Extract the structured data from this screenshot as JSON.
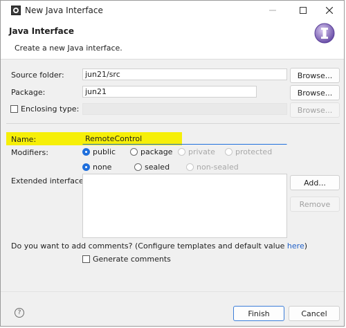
{
  "window": {
    "title": "New Java Interface"
  },
  "header": {
    "title": "Java Interface",
    "description": "Create a new Java interface."
  },
  "source_folder": {
    "label": "Source folder:",
    "value": "jun21/src",
    "browse_label": "Browse..."
  },
  "package": {
    "label": "Package:",
    "value": "jun21",
    "browse_label": "Browse..."
  },
  "enclosing_type": {
    "label": "Enclosing type:",
    "value": "",
    "browse_label": "Browse..."
  },
  "name": {
    "label": "Name:",
    "value": "RemoteControl"
  },
  "modifiers": {
    "label": "Modifiers:",
    "access": [
      {
        "label": "public",
        "selected": true,
        "enabled": true
      },
      {
        "label": "package",
        "selected": false,
        "enabled": true
      },
      {
        "label": "private",
        "selected": false,
        "enabled": false
      },
      {
        "label": "protected",
        "selected": false,
        "enabled": false
      }
    ],
    "sealing": [
      {
        "label": "none",
        "selected": true,
        "enabled": true
      },
      {
        "label": "sealed",
        "selected": false,
        "enabled": true
      },
      {
        "label": "non-sealed",
        "selected": false,
        "enabled": false
      }
    ]
  },
  "extended_interfaces": {
    "label": "Extended interfaces:",
    "add_label": "Add...",
    "remove_label": "Remove"
  },
  "comments": {
    "question_prefix": "Do you want to add comments? (Configure templates and default value ",
    "link_text": "here",
    "question_suffix": ")",
    "checkbox_label": "Generate comments",
    "checked": false
  },
  "footer": {
    "finish_label": "Finish",
    "cancel_label": "Cancel",
    "help_icon": "help-icon"
  },
  "colors": {
    "highlight": "#f6ef08",
    "accent": "#1f6fdc",
    "link": "#1f5fc7"
  }
}
